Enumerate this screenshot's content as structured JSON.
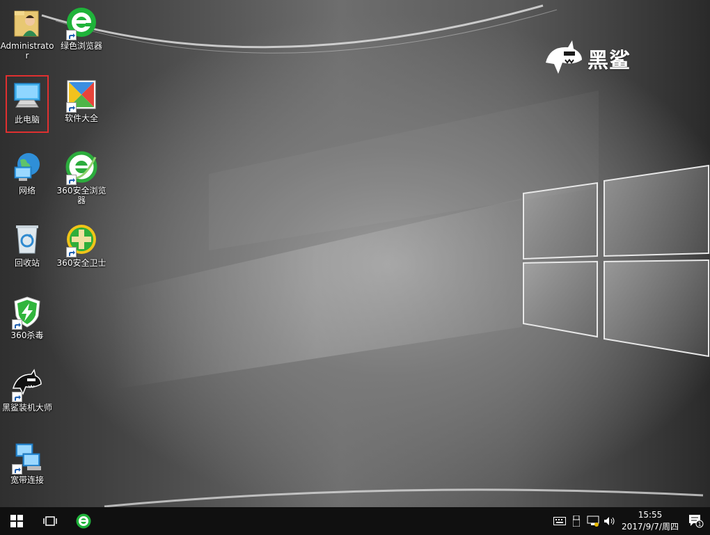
{
  "desktop": {
    "icons": [
      {
        "label": "Administrator",
        "icon": "user-folder-icon"
      },
      {
        "label": "绿色浏览器",
        "icon": "green-browser-icon"
      },
      {
        "label": "此电脑",
        "icon": "this-pc-icon"
      },
      {
        "label": "软件大全",
        "icon": "software-store-icon"
      },
      {
        "label": "网络",
        "icon": "network-icon"
      },
      {
        "label": "360安全浏览器",
        "icon": "360-browser-icon"
      },
      {
        "label": "回收站",
        "icon": "recycle-bin-icon"
      },
      {
        "label": "360安全卫士",
        "icon": "360-security-icon"
      },
      {
        "label": "360杀毒",
        "icon": "360-antivirus-icon"
      },
      {
        "label": "黑鲨装机大师",
        "icon": "blackshark-installer-icon"
      },
      {
        "label": "宽带连接",
        "icon": "broadband-connection-icon"
      }
    ],
    "selected_icon": "此电脑"
  },
  "brand": {
    "text": "黑鲨",
    "icon": "shark-logo-icon"
  },
  "taskbar": {
    "start": "windows-start-icon",
    "task_view": "task-view-icon",
    "pinned": "green-browser-icon",
    "tray_icons": [
      "keyboard-icon",
      "usb-icon",
      "network-icon",
      "volume-icon"
    ],
    "time": "15:55",
    "date": "2017/9/7/周四",
    "notification_count": "1"
  },
  "colors": {
    "taskbar_bg": "#101010",
    "selection_outline": "#e03030",
    "green_accent": "#1fb33a"
  }
}
